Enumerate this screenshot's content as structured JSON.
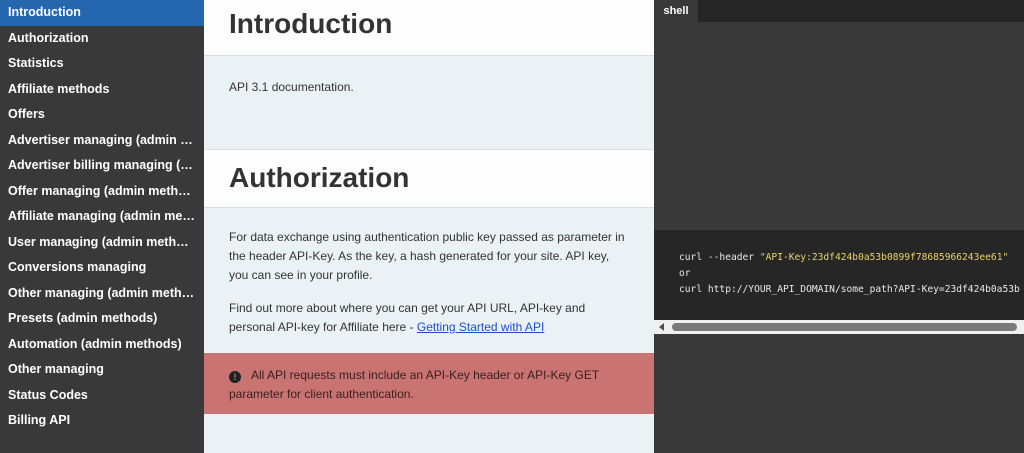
{
  "sidebar": {
    "items": [
      {
        "label": "Introduction",
        "active": true
      },
      {
        "label": "Authorization"
      },
      {
        "label": "Statistics"
      },
      {
        "label": "Affiliate methods"
      },
      {
        "label": "Offers"
      },
      {
        "label": "Advertiser managing (admin methods)"
      },
      {
        "label": "Advertiser billing managing (admin methods)"
      },
      {
        "label": "Offer managing (admin methods)"
      },
      {
        "label": "Affiliate managing (admin methods)"
      },
      {
        "label": "User managing (admin methods)"
      },
      {
        "label": "Conversions managing"
      },
      {
        "label": "Other managing (admin methods)"
      },
      {
        "label": "Presets (admin methods)"
      },
      {
        "label": "Automation (admin methods)"
      },
      {
        "label": "Other managing"
      },
      {
        "label": "Status Codes"
      },
      {
        "label": "Billing API"
      }
    ]
  },
  "main": {
    "intro": {
      "title": "Introduction",
      "text": "API 3.1 documentation."
    },
    "auth": {
      "title": "Authorization",
      "p1": "For data exchange using authentication public key passed as parameter in the header API-Key. As the key, a hash generated for your site. API key, you can see in your profile.",
      "p2_text": "Find out more about where you can get your API URL, API-key and personal API-key for Affiliate here - ",
      "p2_link": "Getting Started with API"
    },
    "warning": {
      "icon": "exclamation-icon",
      "text": "All API requests must include an API-Key header or API-Key GET parameter for client authentication."
    }
  },
  "code_panel": {
    "tab_label": "shell",
    "line1_cmd": "curl --header ",
    "line1_str": "\"API-Key:23df424b0a53b0899f78685966243ee61\"",
    "line2": "or",
    "line3": "curl http://YOUR_API_DOMAIN/some_path?API-Key=23df424b0a53b"
  },
  "colors": {
    "sidebar_bg": "#393939",
    "sidebar_active": "#2467af",
    "warning_bg": "#c97373",
    "content_bg": "#eaf2f6",
    "code_bg": "#262626",
    "string_color": "#e9d26a"
  }
}
